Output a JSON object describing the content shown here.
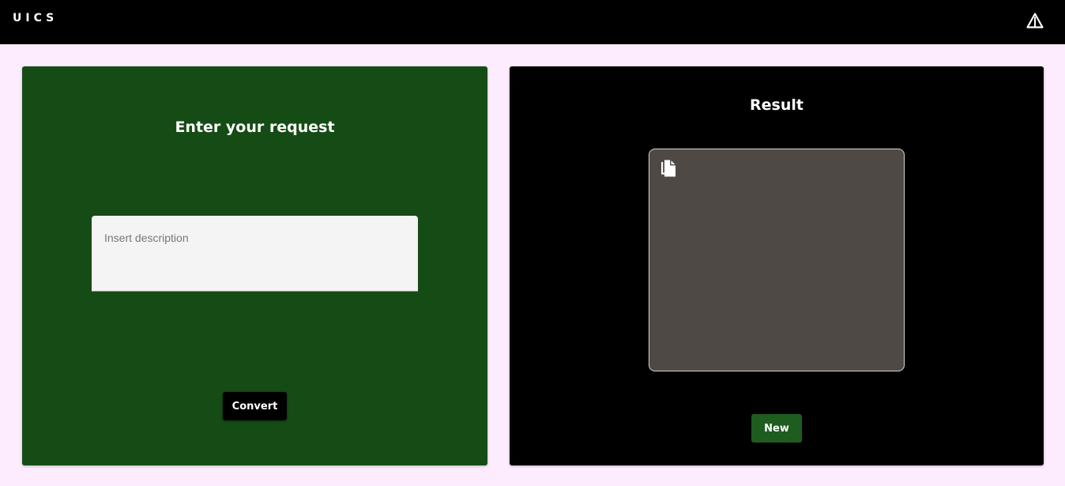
{
  "app": {
    "logo": "UICS"
  },
  "header": {
    "warning_icon": "warning-triangle-icon"
  },
  "request_panel": {
    "title": "Enter your request",
    "input": {
      "value": "",
      "placeholder": "Insert description"
    },
    "convert_label": "Convert",
    "background_color": "#154c15"
  },
  "result_panel": {
    "title": "Result",
    "copy_icon": "copy-icon",
    "result_text": "",
    "new_label": "New",
    "background_color": "#000000"
  },
  "colors": {
    "page_background": "#fcecfd",
    "topbar": "#000000",
    "result_box": "#4e4944",
    "new_button": "#1f5c1f"
  }
}
